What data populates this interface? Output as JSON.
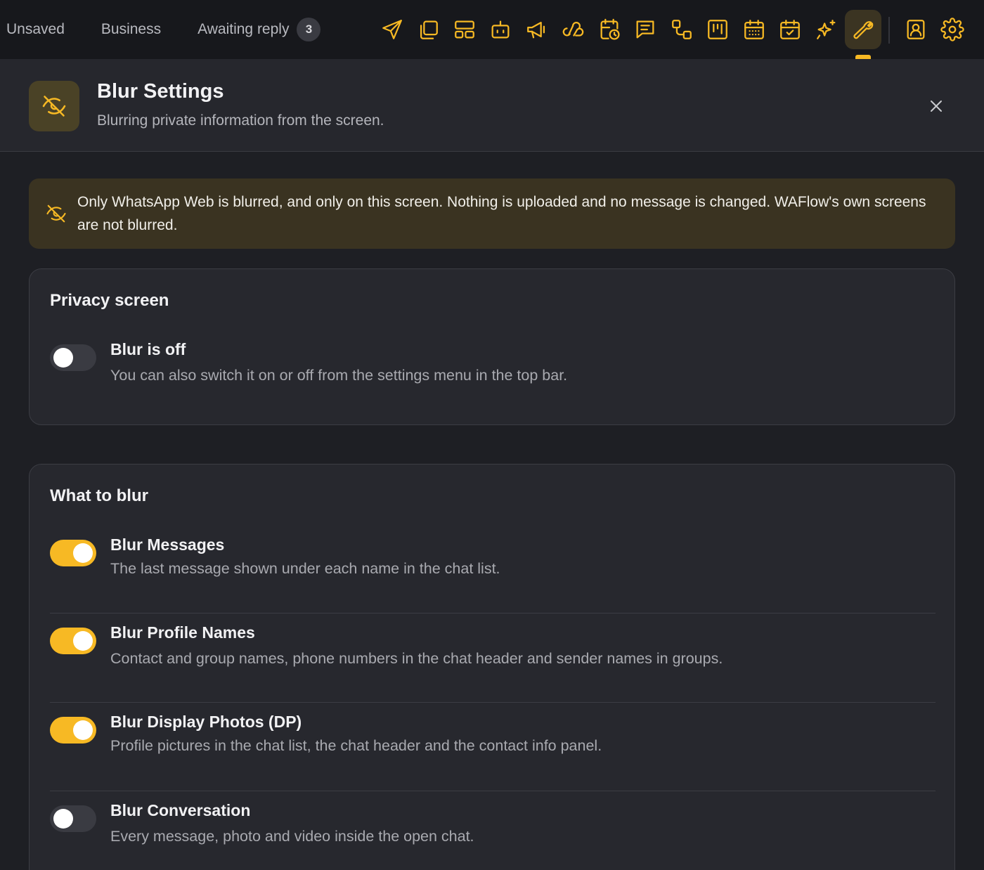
{
  "topbar": {
    "tabs": [
      {
        "label": "Unsaved"
      },
      {
        "label": "Business"
      },
      {
        "label": "Awaiting reply",
        "count": "3"
      }
    ],
    "icons": [
      "send-icon",
      "copy-icon",
      "layout-icon",
      "bot-icon",
      "megaphone-icon",
      "webhook-icon",
      "calendar-clock-icon",
      "message-lines-icon",
      "workflow-icon",
      "kanban-icon",
      "calendar-grid-icon",
      "calendar-check-icon",
      "sparkles-icon",
      "wrench-icon",
      "contact-icon",
      "gear-icon"
    ],
    "active_icon": "wrench-icon",
    "accent_color": "#f7b924"
  },
  "header": {
    "title": "Blur Settings",
    "subtitle": "Blurring private information from the screen."
  },
  "notice": {
    "text": "Only WhatsApp Web is blurred, and only on this screen. Nothing is uploaded and no message is changed. WAFlow's own screens are not blurred."
  },
  "privacy_card": {
    "title": "Privacy screen",
    "setting": {
      "title": "Blur is off",
      "description": "You can also switch it on or off from the settings menu in the top bar.",
      "enabled": false
    }
  },
  "blur_card": {
    "title": "What to blur",
    "settings": [
      {
        "title": "Blur Messages",
        "description": "The last message shown under each name in the chat list.",
        "enabled": true
      },
      {
        "title": "Blur Profile Names",
        "description": "Contact and group names, phone numbers in the chat header and sender names in groups.",
        "enabled": true
      },
      {
        "title": "Blur Display Photos (DP)",
        "description": "Profile pictures in the chat list, the chat header and the contact info panel.",
        "enabled": true
      },
      {
        "title": "Blur Conversation",
        "description": "Every message, photo and video inside the open chat.",
        "enabled": false
      }
    ]
  }
}
